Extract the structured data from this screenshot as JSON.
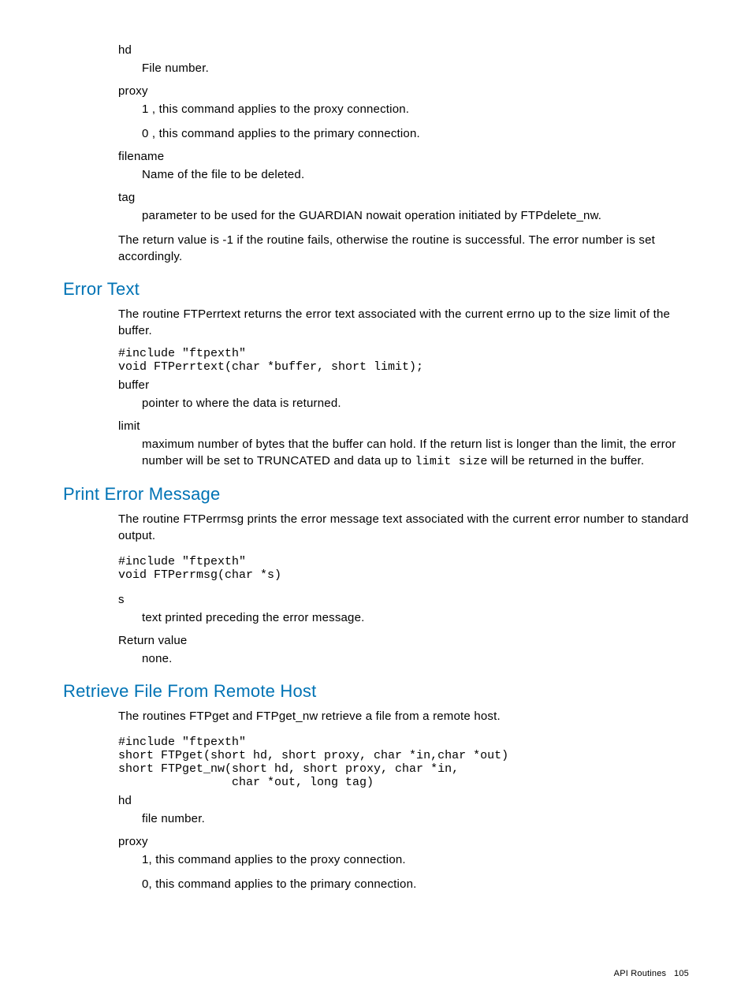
{
  "top": {
    "hd": {
      "label": "hd",
      "def": "File number."
    },
    "proxy": {
      "label": "proxy",
      "l1": "1 , this command applies to the proxy connection.",
      "l0": "0 , this command applies to the primary connection."
    },
    "filename": {
      "label": "filename",
      "def": "Name of the file to be deleted."
    },
    "tag": {
      "label": "tag",
      "def": "parameter to be used for the GUARDIAN nowait operation initiated by FTPdelete_nw."
    },
    "ret": "The return value is -1 if the routine fails, otherwise the routine is successful. The error number is set accordingly."
  },
  "errortext": {
    "heading": "Error Text",
    "intro": "The routine FTPerrtext returns the error text associated with the current errno up to the size limit of the buffer.",
    "code": "#include \"ftpexth\"\nvoid FTPerrtext(char *buffer, short limit);",
    "buffer": {
      "label": "buffer",
      "def": "pointer to where the data is returned."
    },
    "limit": {
      "label": "limit",
      "def_pre": "maximum number of bytes that the buffer can hold. If the return list is longer than the limit, the error number will be set to TRUNCATED and data up to ",
      "def_mono": "limit size",
      "def_post": " will be returned in the buffer."
    }
  },
  "printerr": {
    "heading": "Print Error Message",
    "intro": "The routine FTPerrmsg prints the error message text associated with the current error number to standard output.",
    "code": "#include \"ftpexth\"\nvoid FTPerrmsg(char *s)",
    "s": {
      "label": "s",
      "def": "text printed preceding the error message."
    },
    "retlabel": "Return value",
    "retval": "none."
  },
  "retrieve": {
    "heading": "Retrieve File From Remote Host",
    "intro": "The routines FTPget and FTPget_nw retrieve a file from a remote host.",
    "code": "#include \"ftpexth\"\nshort FTPget(short hd, short proxy, char *in,char *out)\nshort FTPget_nw(short hd, short proxy, char *in,\n                char *out, long tag)",
    "hd": {
      "label": "hd",
      "def": "file number."
    },
    "proxy": {
      "label": "proxy",
      "l1": "1, this command applies to the proxy connection.",
      "l0": "0, this command applies to the primary connection."
    }
  },
  "footer": {
    "section": "API Routines",
    "page": "105"
  }
}
